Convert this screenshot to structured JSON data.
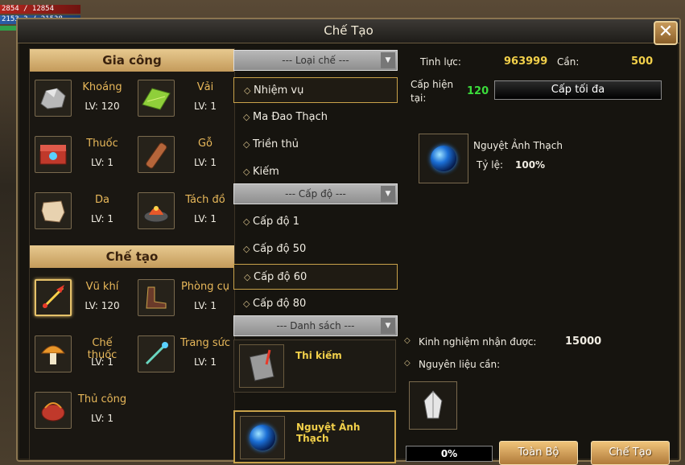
{
  "hud": {
    "hp": "2854 / 12854",
    "mp": "2153 3 / 21538"
  },
  "window": {
    "title": "Chế Tạo",
    "close_label": "✕"
  },
  "gia_cong": {
    "header": "Gia công",
    "skills": [
      {
        "name": "Khoáng",
        "lv": "LV: 120",
        "icon": "ore-icon"
      },
      {
        "name": "Vải",
        "lv": "LV: 1",
        "icon": "cloth-icon"
      },
      {
        "name": "Thuốc",
        "lv": "LV: 1",
        "icon": "medicine-box-icon"
      },
      {
        "name": "Gỗ",
        "lv": "LV: 1",
        "icon": "wood-icon"
      },
      {
        "name": "Da",
        "lv": "LV: 1",
        "icon": "leather-icon"
      },
      {
        "name": "Tách đồ",
        "lv": "LV: 1",
        "icon": "disassemble-icon"
      }
    ]
  },
  "che_tao": {
    "header": "Chế tạo",
    "skills": [
      {
        "name": "Vũ khí",
        "lv": "LV: 120",
        "icon": "weapon-icon"
      },
      {
        "name": "Phòng cụ",
        "lv": "LV: 1",
        "icon": "boots-icon"
      },
      {
        "name": "Chế thuốc",
        "lv": "LV: 1",
        "icon": "mushroom-icon"
      },
      {
        "name": "Trang sức",
        "lv": "LV: 1",
        "icon": "jewelry-icon"
      },
      {
        "name": "Thủ công",
        "lv": "LV: 1",
        "icon": "basket-icon"
      }
    ]
  },
  "filters": {
    "type_dropdown": "--- Loại chế ---",
    "types": [
      "Nhiệm vụ",
      "Ma Đao Thạch",
      "Triền thủ",
      "Kiếm"
    ],
    "level_dropdown": "--- Cấp độ ---",
    "levels": [
      "Cấp độ 1",
      "Cấp độ 50",
      "Cấp độ 60",
      "Cấp độ 80"
    ],
    "list_dropdown": "--- Danh sách ---",
    "recipes": [
      "Thi kiếm",
      "Nguyệt Ảnh Thạch"
    ]
  },
  "detail": {
    "tinh_luc_label": "Tinh lực:",
    "tinh_luc_value": "963999",
    "can_label": "Cần:",
    "can_value": "500",
    "cap_hien_tai_label_1": "Cấp hiện",
    "cap_hien_tai_label_2": "tại:",
    "cap_hien_tai_value": "120",
    "max_level_button": "Cấp tối đa",
    "result_name": "Nguyệt Ảnh Thạch",
    "ty_le_label": "Tỷ lệ:",
    "ty_le_value": "100%",
    "exp_label": "Kinh nghiệm nhận được:",
    "exp_value": "15000",
    "material_label": "Nguyên liệu cần:",
    "progress": "0%",
    "progress_fraction": 0,
    "all_button": "Toàn Bộ",
    "craft_button": "Chế Tạo"
  },
  "colors": {
    "accent_gold": "#f2d04a",
    "green": "#3bdc3b",
    "orange": "#e8b85a"
  }
}
